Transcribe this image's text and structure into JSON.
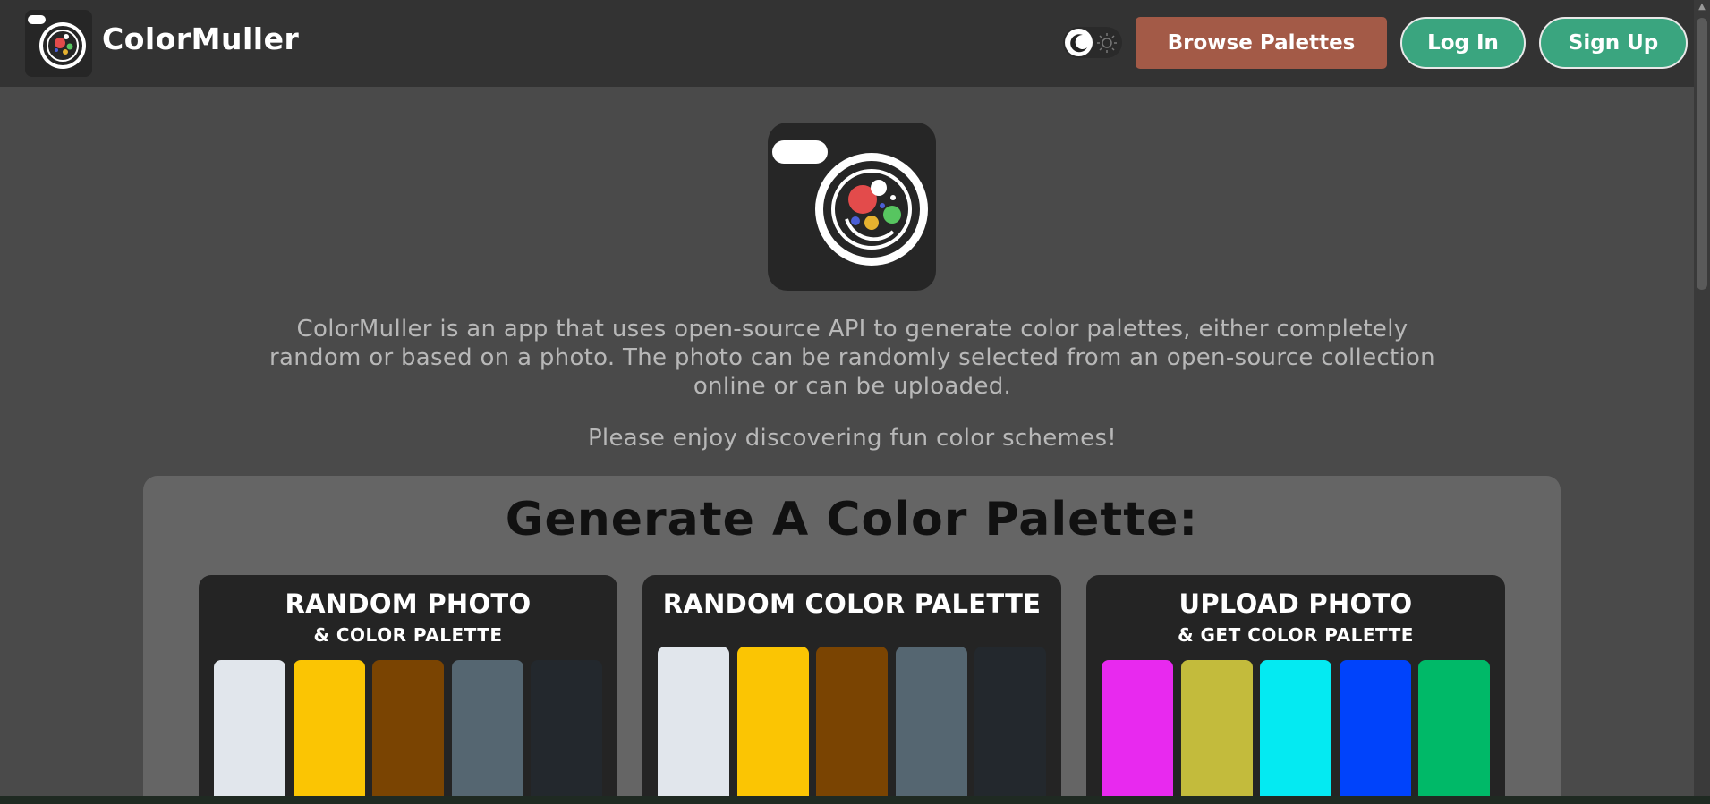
{
  "brand": {
    "name": "ColorMuller"
  },
  "nav": {
    "browse_label": "Browse Palettes",
    "login_label": "Log In",
    "signup_label": "Sign Up",
    "theme_toggle": {
      "dark_icon": "moon-icon",
      "light_icon": "sun-icon"
    }
  },
  "hero": {
    "intro_line1": "ColorMuller is an app that uses open-source API to generate color palettes, either completely",
    "intro_line2": "random or based on a photo. The photo can be randomly selected from an open-source collection",
    "intro_line3": "online or can be uploaded.",
    "tagline": "Please enjoy discovering fun color schemes!"
  },
  "generate": {
    "title": "Generate A Color Palette:",
    "cards": [
      {
        "title": "RANDOM PHOTO",
        "subtitle": "& COLOR PALETTE",
        "colors": [
          "#e1e6ec",
          "#fbc503",
          "#7a4402",
          "#556671",
          "#23282d"
        ]
      },
      {
        "title": "RANDOM COLOR PALETTE",
        "subtitle": "",
        "colors": [
          "#e1e6ec",
          "#fbc503",
          "#7a4402",
          "#556671",
          "#23282d"
        ]
      },
      {
        "title": "UPLOAD PHOTO",
        "subtitle": "& GET COLOR PALETTE",
        "colors": [
          "#e829ef",
          "#c3bb3c",
          "#04eaf2",
          "#0043fb",
          "#00b968"
        ]
      }
    ]
  },
  "colors": {
    "navbar": "#333333",
    "background": "#4a4a4a",
    "browse_button": "#a35a47",
    "auth_button": "#3aa57f"
  }
}
